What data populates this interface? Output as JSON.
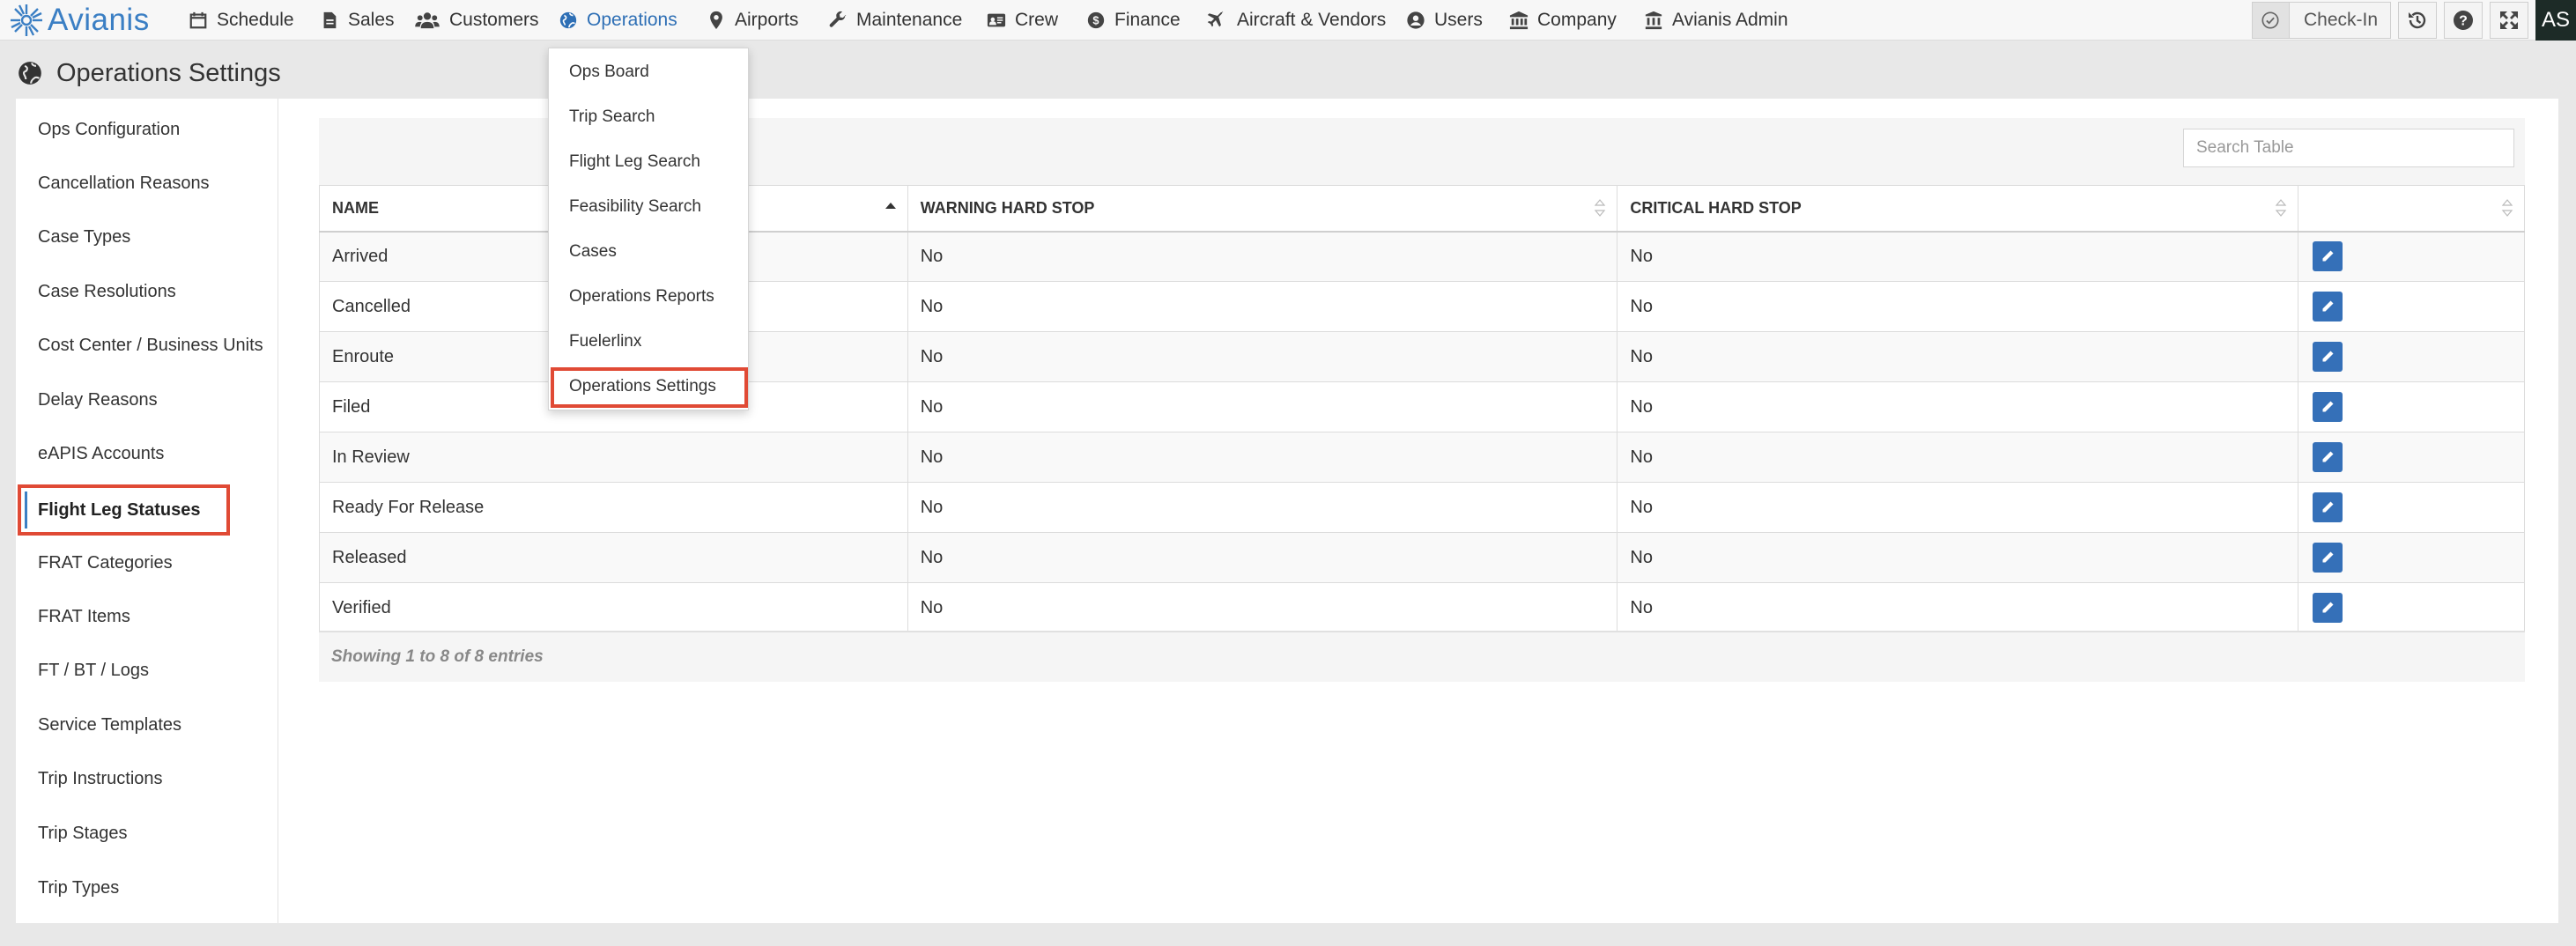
{
  "app": {
    "brand": "Avianis"
  },
  "nav": {
    "items": [
      {
        "label": "Schedule",
        "icon": "calendar-icon"
      },
      {
        "label": "Sales",
        "icon": "file-icon"
      },
      {
        "label": "Customers",
        "icon": "users-icon"
      },
      {
        "label": "Operations",
        "icon": "globe-icon",
        "active": true
      },
      {
        "label": "Airports",
        "icon": "map-pin-icon"
      },
      {
        "label": "Maintenance",
        "icon": "wrench-icon"
      },
      {
        "label": "Crew",
        "icon": "id-card-icon"
      },
      {
        "label": "Finance",
        "icon": "dollar-icon"
      },
      {
        "label": "Aircraft & Vendors",
        "icon": "plane-icon"
      },
      {
        "label": "Users",
        "icon": "user-circle-icon"
      },
      {
        "label": "Company",
        "icon": "bank-icon"
      },
      {
        "label": "Avianis Admin",
        "icon": "admin-icon"
      }
    ],
    "checkin_label": "Check-In",
    "avatar_initials": "AS"
  },
  "page": {
    "title": "Operations Settings"
  },
  "sidebar": {
    "items": [
      {
        "label": "Ops Configuration"
      },
      {
        "label": "Cancellation Reasons"
      },
      {
        "label": "Case Types"
      },
      {
        "label": "Case Resolutions"
      },
      {
        "label": "Cost Center / Business Units"
      },
      {
        "label": "Delay Reasons"
      },
      {
        "label": "eAPIS Accounts"
      },
      {
        "label": "Flight Leg Statuses",
        "active": true
      },
      {
        "label": "FRAT Categories"
      },
      {
        "label": "FRAT Items"
      },
      {
        "label": "FT / BT / Logs"
      },
      {
        "label": "Service Templates"
      },
      {
        "label": "Trip Instructions"
      },
      {
        "label": "Trip Stages"
      },
      {
        "label": "Trip Types"
      }
    ]
  },
  "table": {
    "search_placeholder": "Search Table",
    "headers": {
      "name": "NAME",
      "warning": "WARNING HARD STOP",
      "critical": "CRITICAL HARD STOP"
    },
    "rows": [
      {
        "name": "Arrived",
        "warning": "No",
        "critical": "No"
      },
      {
        "name": "Cancelled",
        "warning": "No",
        "critical": "No"
      },
      {
        "name": "Enroute",
        "warning": "No",
        "critical": "No"
      },
      {
        "name": "Filed",
        "warning": "No",
        "critical": "No"
      },
      {
        "name": "In Review",
        "warning": "No",
        "critical": "No"
      },
      {
        "name": "Ready For Release",
        "warning": "No",
        "critical": "No"
      },
      {
        "name": "Released",
        "warning": "No",
        "critical": "No"
      },
      {
        "name": "Verified",
        "warning": "No",
        "critical": "No"
      }
    ],
    "footer": "Showing 1 to 8 of 8 entries"
  },
  "operations_menu": {
    "items": [
      {
        "label": "Ops Board"
      },
      {
        "label": "Trip Search"
      },
      {
        "label": "Flight Leg Search"
      },
      {
        "label": "Feasibility Search"
      },
      {
        "label": "Cases"
      },
      {
        "label": "Operations Reports"
      },
      {
        "label": "Fuelerlinx"
      },
      {
        "label": "Operations Settings",
        "highlighted": true
      }
    ]
  },
  "colors": {
    "brand": "#3b7fc4",
    "active_nav": "#2e6fb5",
    "edit_button": "#3570b8",
    "highlight_border": "#e04a35"
  }
}
